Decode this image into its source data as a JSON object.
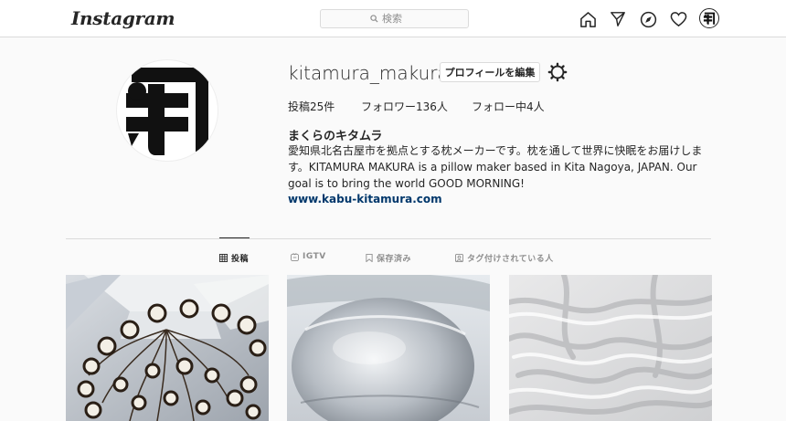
{
  "header": {
    "logo": "Instagram",
    "search_placeholder": "検索"
  },
  "profile": {
    "username": "kitamura_makura",
    "edit_button": "プロフィールを編集",
    "stats": {
      "posts": "投稿25件",
      "followers": "フォロワー136人",
      "following": "フォロー中4人"
    },
    "full_name": "まくらのキタムラ",
    "bio": "愛知県北名古屋市を拠点とする枕メーカーです。枕を通して世界に快眠をお届けします。KITAMURA MAKURA is a pillow maker based in Kita Nagoya, JAPAN. Our goal is to bring the world GOOD MORNING!",
    "link": "www.kabu-kitamura.com"
  },
  "tabs": [
    {
      "label": "投稿",
      "icon": "grid-icon",
      "active": true
    },
    {
      "label": "IGTV",
      "icon": "igtv-icon",
      "active": false
    },
    {
      "label": "保存済み",
      "icon": "bookmark-icon",
      "active": false
    },
    {
      "label": "タグ付けされている人",
      "icon": "tagged-icon",
      "active": false
    }
  ],
  "posts": [
    {
      "subject": "chandelier"
    },
    {
      "subject": "pillow"
    },
    {
      "subject": "sheets"
    }
  ]
}
